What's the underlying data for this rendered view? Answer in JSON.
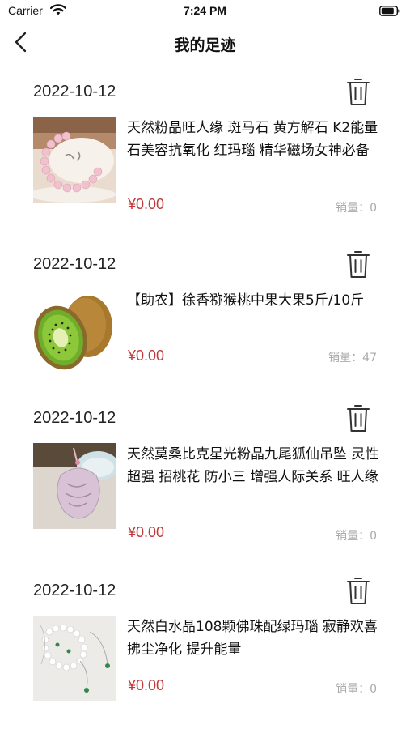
{
  "status_bar": {
    "carrier": "Carrier",
    "time": "7:24 PM"
  },
  "nav": {
    "title": "我的足迹"
  },
  "colors": {
    "price": "#c0393b",
    "sales": "#aaaaaa",
    "text": "#111111"
  },
  "items": [
    {
      "date": "2022-10-12",
      "title": "天然粉晶旺人缘 斑马石 黄方解石 K2能量石美容抗氧化 红玛瑙 精华磁场女神必备",
      "price": "¥0.00",
      "sales": "销量：0",
      "image": "pink-crystal-bracelet"
    },
    {
      "date": "2022-10-12",
      "title": "【助农】徐香猕猴桃中果大果5斤/10斤",
      "price": "¥0.00",
      "sales": "销量：47",
      "image": "kiwi-fruit"
    },
    {
      "date": "2022-10-12",
      "title": "天然莫桑比克星光粉晶九尾狐仙吊坠 灵性超强 招桃花 防小三 增强人际关系 旺人缘",
      "price": "¥0.00",
      "sales": "销量：0",
      "image": "pink-fox-pendant"
    },
    {
      "date": "2022-10-12",
      "title": "天然白水晶108颗佛珠配绿玛瑙 寂静欢喜 拂尘净化 提升能量",
      "price": "¥0.00",
      "sales": "销量：0",
      "image": "white-crystal-beads"
    }
  ]
}
